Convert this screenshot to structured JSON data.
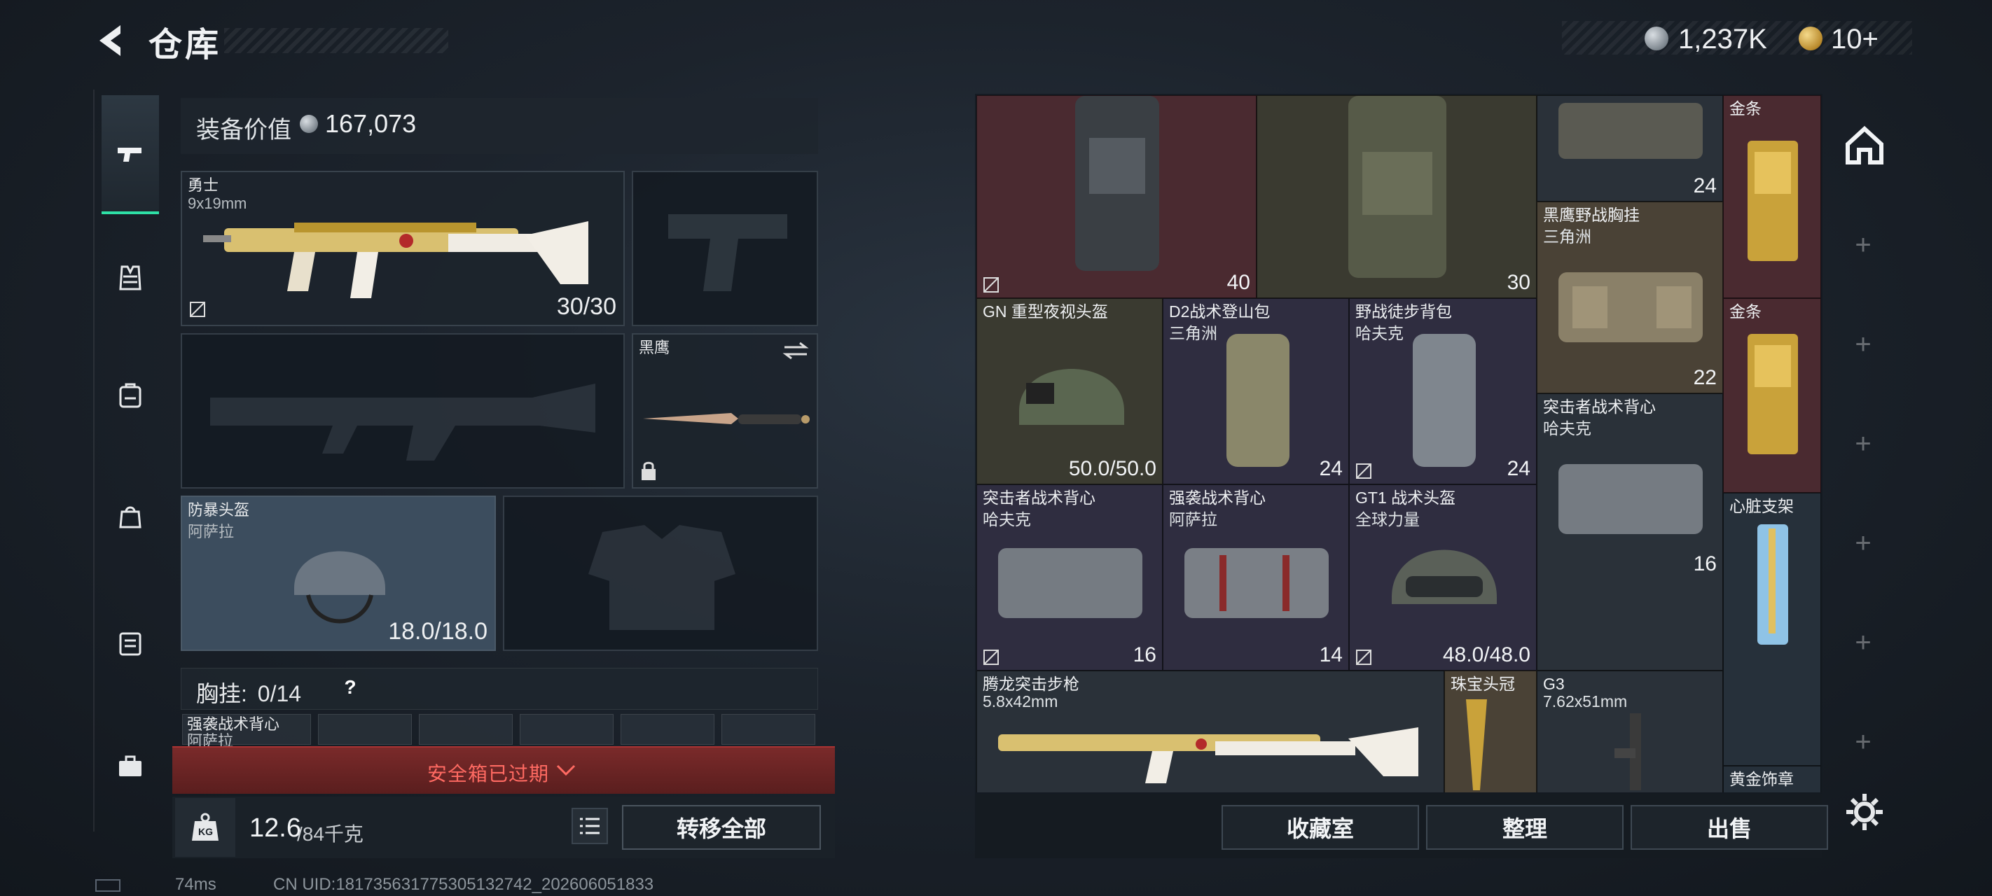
{
  "header": {
    "title": "仓库",
    "currency_silver": "1,237K",
    "currency_gold": "10+"
  },
  "loadout": {
    "equip_value_label": "装备价值",
    "equip_value": "167,073",
    "primary_weapon": {
      "name": "勇士",
      "caliber": "9x19mm",
      "ammo": "30/30"
    },
    "melee": {
      "name": "黑鹰"
    },
    "helmet": {
      "name": "防暴头盔",
      "brand": "阿萨拉",
      "durability": "18.0/18.0"
    },
    "chest_rig": {
      "label": "胸挂:",
      "count": "0/14",
      "help": "?"
    },
    "backpack_preview": {
      "name": "强袭战术背心",
      "brand": "阿萨拉"
    },
    "safe_box_text": "安全箱已过期",
    "weight_current": "12.6",
    "weight_max": "/84千克",
    "transfer_all": "转移全部"
  },
  "stash": {
    "items": [
      {
        "id": "r0c0",
        "name": "",
        "sub": "",
        "num": "40"
      },
      {
        "id": "r0c1",
        "name": "",
        "sub": "",
        "num": "30"
      },
      {
        "id": "r0c3",
        "name": "",
        "sub": "",
        "num": "24"
      },
      {
        "id": "r0c4",
        "name": "金条",
        "sub": "",
        "num": ""
      },
      {
        "id": "r1c3",
        "name": "黑鹰野战胸挂",
        "sub": "三角洲",
        "num": "22"
      },
      {
        "id": "r1c4",
        "name": "金条",
        "sub": "",
        "num": ""
      },
      {
        "id": "r2c0",
        "name": "GN 重型夜视头盔",
        "sub": "",
        "num": "50.0/50.0"
      },
      {
        "id": "r2c1",
        "name": "D2战术登山包",
        "sub": "三角洲",
        "num": "24"
      },
      {
        "id": "r2c2",
        "name": "野战徒步背包",
        "sub": "哈夫克",
        "num": "24"
      },
      {
        "id": "r3c3",
        "name": "突击者战术背心",
        "sub": "哈夫克",
        "num": "16"
      },
      {
        "id": "r3c0",
        "name": "突击者战术背心",
        "sub": "哈夫克",
        "num": "16"
      },
      {
        "id": "r3c1",
        "name": "强袭战术背心",
        "sub": "阿萨拉",
        "num": "14"
      },
      {
        "id": "r3c2",
        "name": "GT1 战术头盔",
        "sub": "全球力量",
        "num": "48.0/48.0"
      },
      {
        "id": "r3c4",
        "name": "心脏支架",
        "sub": "",
        "num": ""
      },
      {
        "id": "r4c3",
        "name": "G3",
        "sub": "7.62x51mm",
        "num": ""
      },
      {
        "id": "r5c0",
        "name": "腾龙突击步枪",
        "sub": "5.8x42mm",
        "num": ""
      },
      {
        "id": "r5c2",
        "name": "珠宝头冠",
        "sub": "",
        "num": ""
      },
      {
        "id": "r5c4",
        "name": "黄金饰章",
        "sub": "",
        "num": ""
      }
    ],
    "footer": {
      "collection": "收藏室",
      "organize": "整理",
      "sell": "出售"
    }
  },
  "status": {
    "ping": "74ms",
    "uid": "CN UID:181735631775305132742_202606051833"
  },
  "colors": {
    "accent": "#2ee0a6",
    "warning": "#ff6a62",
    "gold": "#c9a23a"
  }
}
